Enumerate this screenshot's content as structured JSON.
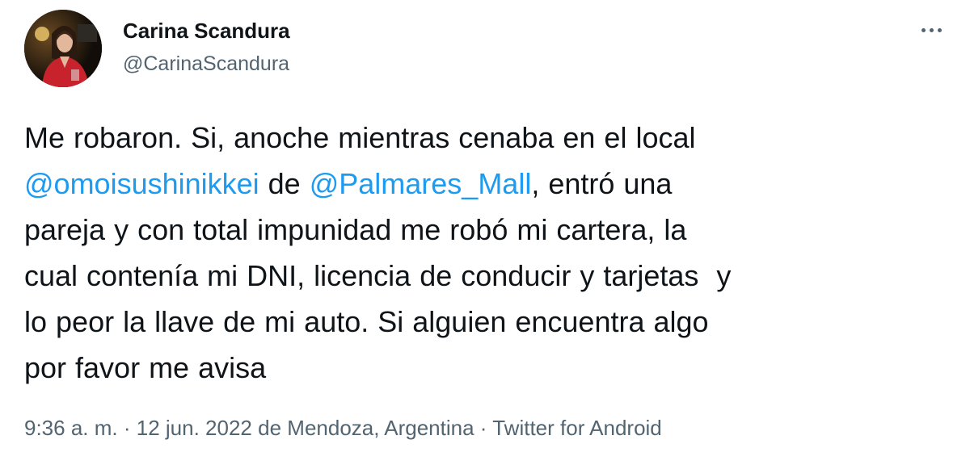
{
  "author": {
    "name": "Carina Scandura",
    "handle": "@CarinaScandura"
  },
  "tweet": {
    "lines": [
      [
        {
          "text": "Me robaron. Si, anoche mientras cenaba en el local",
          "mention": false
        }
      ],
      [
        {
          "text": "@omoisushinikkei",
          "mention": true
        },
        {
          "text": " de ",
          "mention": false
        },
        {
          "text": "@Palmares_Mall",
          "mention": true
        },
        {
          "text": ", entró una",
          "mention": false
        }
      ],
      [
        {
          "text": "pareja y con total impunidad me robó mi cartera, la",
          "mention": false
        }
      ],
      [
        {
          "text": "cual contenía mi DNI, licencia de conducir y tarjetas  y",
          "mention": false
        }
      ],
      [
        {
          "text": "lo peor la llave de mi auto. Si alguien encuentra algo",
          "mention": false
        }
      ],
      [
        {
          "text": "por favor me avisa",
          "mention": false
        }
      ]
    ]
  },
  "meta": {
    "time": "9:36 a. m.",
    "separator": "·",
    "date": "12 jun. 2022",
    "location": "de Mendoza, Argentina",
    "source": "Twitter for Android"
  },
  "colors": {
    "text": "#0f1419",
    "secondary": "#536471",
    "link": "#1d9bf0"
  },
  "icons": {
    "more": "more-horizontal-icon"
  }
}
